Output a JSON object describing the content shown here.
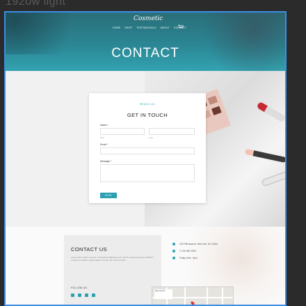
{
  "editor": {
    "frame_label": "1920w light"
  },
  "header": {
    "logo": "Cosmetic",
    "nav": [
      "Home",
      "Shop",
      "Testimonials",
      "About",
      "Contact"
    ],
    "hero_title": "CONTACT"
  },
  "contact_form": {
    "eyebrow": "Reach us",
    "title": "GET IN TOUCH",
    "name_label": "Name *",
    "first_sub": "First",
    "last_sub": "Last",
    "email_label": "Email *",
    "message_label": "Message *",
    "send_label": "Send"
  },
  "info": {
    "title": "CONTACT US",
    "text": "Lorem ipsum dolor sit amet, consectetur adipiscing elit, sed do eiusmod tempor incididunt ut labore et dolore magna aliqua. Ut enim ad minim veniam.",
    "follow_label": "Follow us",
    "rows": [
      "123 Fifth Avenue, New York, NY 10160",
      "+1 234 567 8910",
      "Friday, 9am - 6pm"
    ],
    "map_card": "New York, NY"
  },
  "colors": {
    "accent": "#2aa0b0",
    "hero": "#2b8694",
    "selection": "#3b8ee6"
  }
}
